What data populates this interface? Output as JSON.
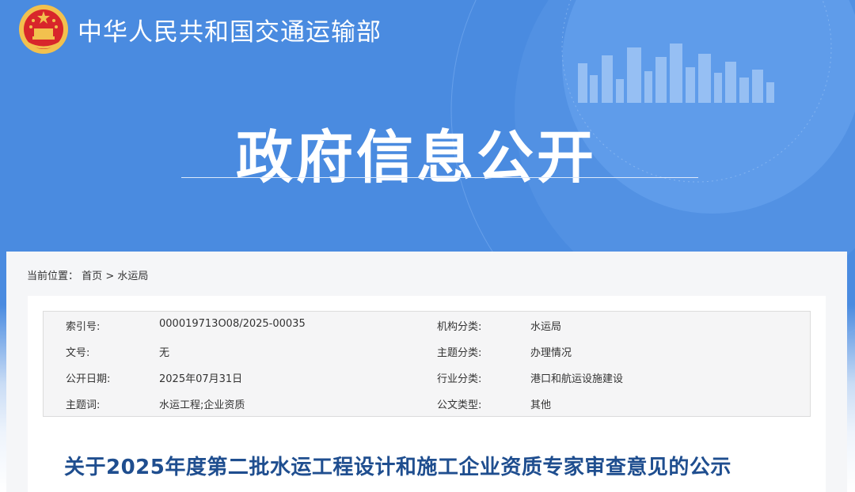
{
  "header": {
    "site_name": "中华人民共和国交通运输部",
    "banner_title": "政府信息公开"
  },
  "breadcrumb": {
    "prefix": "当前位置：",
    "home": "首页",
    "separator": ">",
    "current": "水运局"
  },
  "meta": {
    "rows": [
      {
        "label1": "索引号:",
        "value1": "000019713O08/2025-00035",
        "label2": "机构分类:",
        "value2": "水运局"
      },
      {
        "label1": "文号:",
        "value1": "无",
        "label2": "主题分类:",
        "value2": "办理情况"
      },
      {
        "label1": "公开日期:",
        "value1": "2025年07月31日",
        "label2": "行业分类:",
        "value2": "港口和航运设施建设"
      },
      {
        "label1": "主题词:",
        "value1": "水运工程;企业资质",
        "label2": "公文类型:",
        "value2": "其他"
      }
    ]
  },
  "article": {
    "title": "关于2025年度第二批水运工程设计和施工企业资质专家审查意见的公示"
  },
  "colors": {
    "banner": "#4a8be0",
    "title_blue": "#1f4e8f"
  }
}
